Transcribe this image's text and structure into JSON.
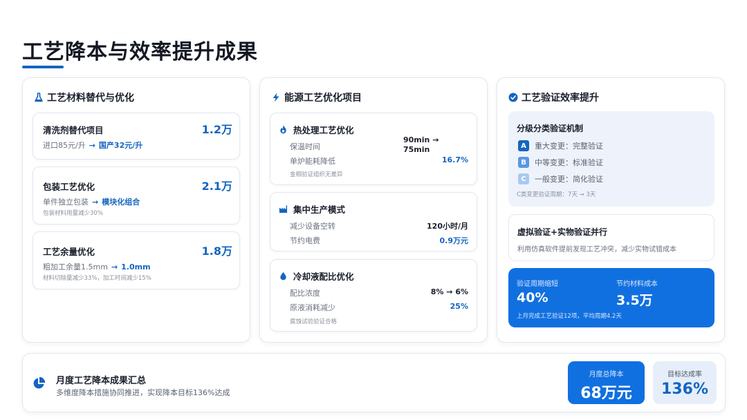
{
  "page": {
    "title": "工艺降本与效率提升成果"
  },
  "colors": {
    "accent": "#1565c0",
    "accent_fill": "#1170e0",
    "light_panel": "#eef3fb"
  },
  "panel1": {
    "title": "工艺材料替代与优化",
    "icon": "flask-icon",
    "cards": [
      {
        "title": "清洗剂替代项目",
        "value": "1.2万",
        "from": "进口85元/升",
        "to": "国产32元/升",
        "note": ""
      },
      {
        "title": "包装工艺优化",
        "value": "2.1万",
        "from": "单件独立包装",
        "to": "模块化组合",
        "note": "包装材料用量减少30%"
      },
      {
        "title": "工艺余量优化",
        "value": "1.8万",
        "from": "粗加工余量1.5mm",
        "to": "1.0mm",
        "note": "材料切除量减少33%，加工时间减少15%"
      }
    ]
  },
  "panel2": {
    "title": "能源工艺优化项目",
    "icon": "lightning-icon",
    "items": [
      {
        "title": "热处理工艺优化",
        "icon": "flame-icon",
        "rows": [
          {
            "label": "保温时间",
            "value": "90min → 75min"
          },
          {
            "label": "单炉能耗降低",
            "value": "16.7%"
          }
        ],
        "note": "金相验证组织无差异"
      },
      {
        "title": "集中生产模式",
        "icon": "factory-icon",
        "rows": [
          {
            "label": "减少设备空转",
            "value": "120小时/月"
          },
          {
            "label": "节约电费",
            "value": "0.9万元"
          }
        ],
        "note": ""
      },
      {
        "title": "冷却液配比优化",
        "icon": "droplet-icon",
        "rows": [
          {
            "label": "配比浓度",
            "value": "8% → 6%"
          },
          {
            "label": "原液消耗减少",
            "value": "25%"
          }
        ],
        "note": "腐蚀试验验证合格"
      }
    ]
  },
  "panel3": {
    "title": "工艺验证效率提升",
    "icon": "check-circle-icon",
    "mechanism": {
      "title": "分级分类验证机制",
      "levels": [
        {
          "badge": "A",
          "text": "重大变更：完整验证"
        },
        {
          "badge": "B",
          "text": "中等变更：标准验证"
        },
        {
          "badge": "C",
          "text": "一般变更：简化验证"
        }
      ],
      "note": "C类变更验证周期：7天 → 3天"
    },
    "parallel": {
      "title": "虚拟验证+实物验证并行",
      "desc": "利用仿真软件提前发现工艺冲突，减少实物试错成本"
    },
    "highlight": {
      "label1": "验证周期缩短",
      "value1": "40%",
      "label2": "节约材料成本",
      "value2": "3.5万",
      "note": "上月完成工艺验证12项，平均周期4.2天"
    }
  },
  "summary": {
    "icon": "pie-chart-icon",
    "title": "月度工艺降本成果汇总",
    "desc": "多维度降本措施协同推进，实现降本目标136%达成",
    "stat1": {
      "label": "月度总降本",
      "value": "68万元"
    },
    "stat2": {
      "label": "目标达成率",
      "value": "136%"
    }
  }
}
